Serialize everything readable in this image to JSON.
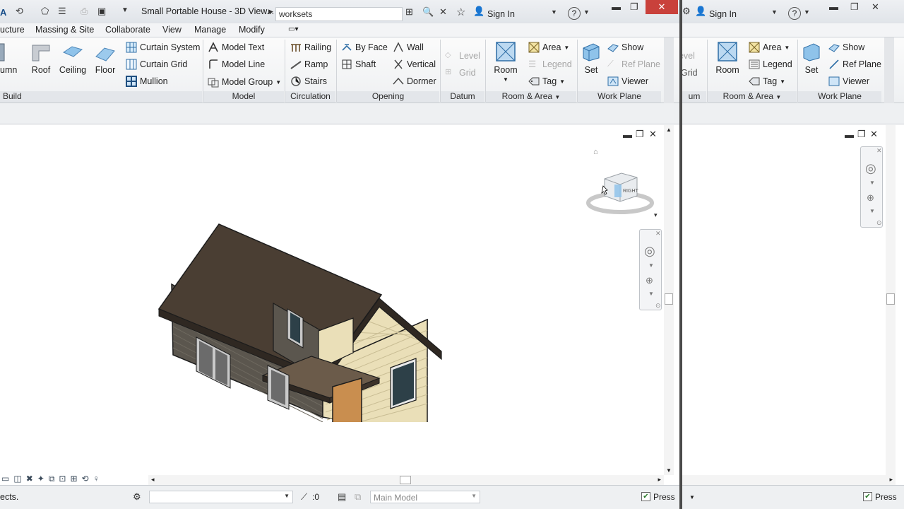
{
  "window_a": {
    "title": "Small Portable House - 3D View...",
    "search_value": "worksets",
    "sign_in": "Sign In",
    "help": "?",
    "tabs": [
      "ucture",
      "Massing & Site",
      "Collaborate",
      "View",
      "Manage",
      "Modify"
    ],
    "build": {
      "items": [
        "umn",
        "Roof",
        "Ceiling",
        "Floor",
        "Curtain System",
        "Curtain Grid",
        "Mullion"
      ],
      "label": "Build"
    },
    "model": {
      "items": [
        "Model Text",
        "Model Line",
        "Model Group"
      ],
      "label": "Model"
    },
    "circulation": {
      "items": [
        "Railing",
        "Ramp",
        "Stairs"
      ],
      "label": "Circulation"
    },
    "opening": {
      "items": [
        "By Face",
        "Shaft",
        "Wall",
        "Vertical",
        "Dormer"
      ],
      "label": "Opening"
    },
    "datum": {
      "items": [
        "Level",
        "Grid"
      ],
      "label": "Datum"
    },
    "room_area": {
      "items": [
        "Room",
        "Area",
        "Legend",
        "Tag"
      ],
      "label": "Room & Area"
    },
    "work_plane": {
      "items": [
        "Set",
        "Show",
        "Ref Plane",
        "Viewer"
      ],
      "label": "Work Plane"
    },
    "viewcube_face": "RIGHT",
    "status": {
      "left": "ects.",
      "worksets": ":0",
      "model": "Main Model",
      "press": "Press"
    }
  },
  "window_b": {
    "sign_in": "Sign In",
    "help": "?",
    "datum": {
      "items": [
        "Level",
        "Grid"
      ],
      "label": "um"
    },
    "room_area": {
      "items": [
        "Room",
        "Area",
        "Legend",
        "Tag"
      ],
      "label": "Room & Area"
    },
    "work_plane": {
      "items": [
        "Set",
        "Show",
        "Ref Plane",
        "Viewer"
      ],
      "label": "Work Plane"
    },
    "status": {
      "press": "Press"
    }
  },
  "colors": {
    "roof": "#4a3e33",
    "siding_dark": "#5b564e",
    "siding_light": "#eadfb8",
    "door": "#c98e4f",
    "window": "#2d4048"
  }
}
